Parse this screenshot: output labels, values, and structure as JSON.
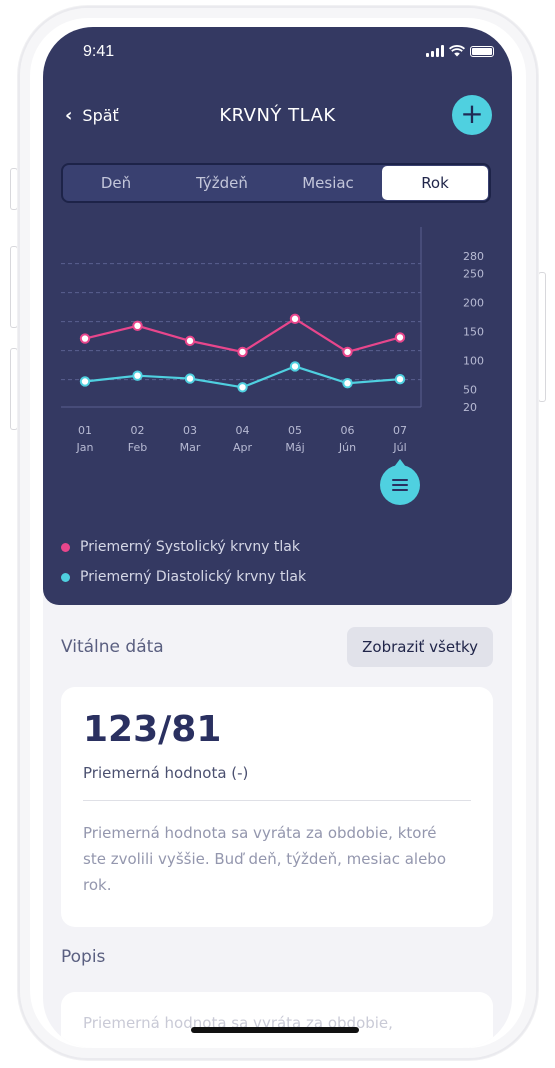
{
  "status": {
    "time": "9:41"
  },
  "nav": {
    "back_label": "Späť",
    "title": "KRVNÝ TLAK",
    "add_icon": "plus-icon"
  },
  "tabs": [
    {
      "label": "Deň",
      "active": false
    },
    {
      "label": "Týždeň",
      "active": false
    },
    {
      "label": "Mesiac",
      "active": false
    },
    {
      "label": "Rok",
      "active": true
    }
  ],
  "colors": {
    "systolic": "#e8468c",
    "diastolic": "#4fd0e0",
    "header_bg": "#343962",
    "accent": "#4fd0e0"
  },
  "chart_data": {
    "type": "line",
    "x_days": [
      "01",
      "02",
      "03",
      "04",
      "05",
      "06",
      "07"
    ],
    "x_months": [
      "Jan",
      "Feb",
      "Mar",
      "Apr",
      "Máj",
      "Jún",
      "Júl"
    ],
    "y_ticks": [
      280,
      250,
      200,
      150,
      100,
      50,
      20
    ],
    "ylim": [
      20,
      280
    ],
    "grid": true,
    "series": [
      {
        "name": "Priemerný Systolický krvny tlak",
        "color": "#e8468c",
        "values": [
          138,
          160,
          134,
          115,
          172,
          115,
          140
        ]
      },
      {
        "name": "Priemerný Diastolický krvny tlak",
        "color": "#4fd0e0",
        "values": [
          64,
          74,
          69,
          54,
          90,
          61,
          68
        ]
      }
    ],
    "highlighted_index": 6
  },
  "legend": [
    {
      "label": "Priemerný Systolický krvny tlak",
      "color": "#e8468c"
    },
    {
      "label": "Priemerný Diastolický krvny tlak",
      "color": "#4fd0e0"
    }
  ],
  "vital": {
    "title": "Vitálne dáta",
    "show_all": "Zobraziť všetky"
  },
  "card": {
    "value": "123/81",
    "label": "Priemerná hodnota (-)",
    "description": "Priemerná hodnota sa vyráta za obdobie, ktoré ste zvolili vyššie. Buď deň, týždeň, mesiac alebo rok."
  },
  "popis": {
    "title": "Popis",
    "description": "Priemerná hodnota sa vyráta za obdobie,"
  }
}
